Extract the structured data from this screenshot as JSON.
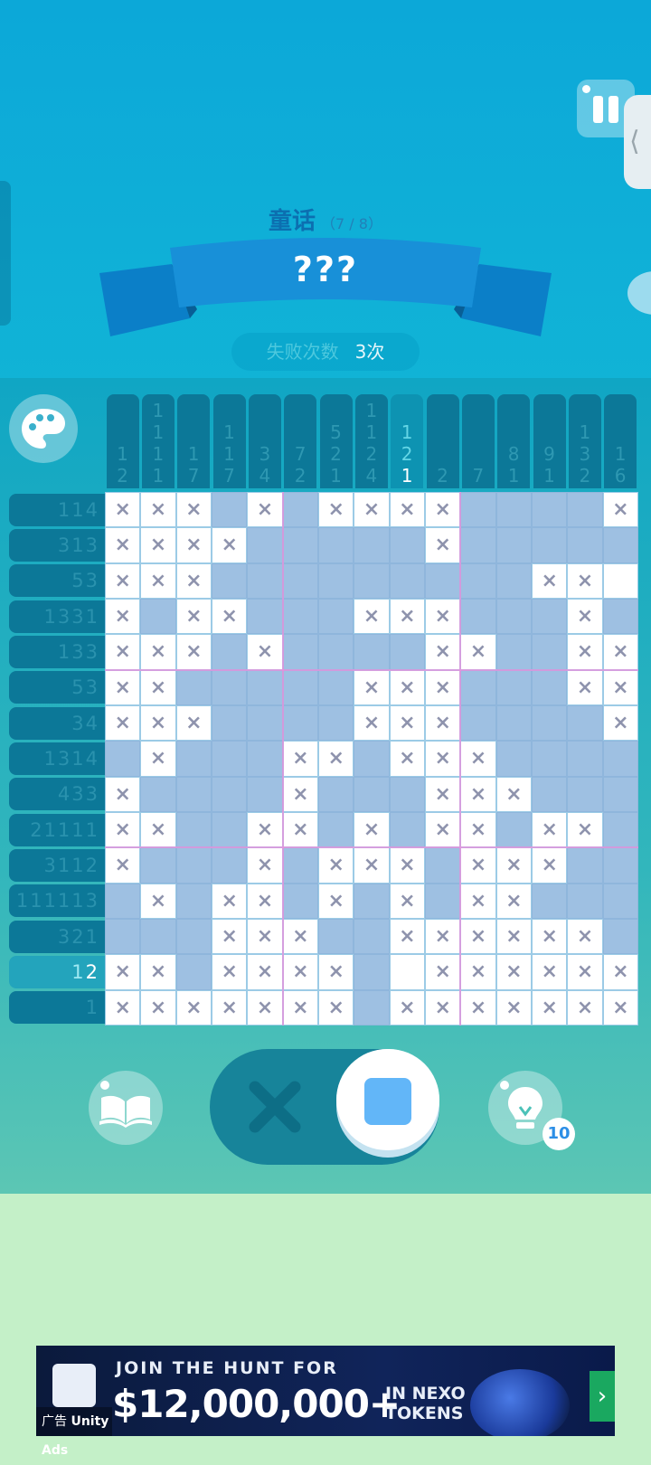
{
  "header": {
    "chapter_name": "童话",
    "chapter_progress": "（7 / 8）",
    "puzzle_title": "???",
    "fail_label": "失败次数",
    "fail_value": "3次",
    "side_tab_glyph": "⟨"
  },
  "board": {
    "size": 15,
    "highlight_col": 8,
    "highlight_row": 13,
    "column_clues": [
      [
        "1",
        "2"
      ],
      [
        "1",
        "1",
        "1",
        "1"
      ],
      [
        "1",
        "7"
      ],
      [
        "1",
        "1",
        "7"
      ],
      [
        "3",
        "4"
      ],
      [
        "7",
        "2"
      ],
      [
        "5",
        "2",
        "1"
      ],
      [
        "1",
        "1",
        "2",
        "4"
      ],
      [
        "1",
        "2",
        "1"
      ],
      [
        "2"
      ],
      [
        "7"
      ],
      [
        "8",
        "1"
      ],
      [
        "9",
        "1"
      ],
      [
        "1",
        "3",
        "2"
      ],
      [
        "1",
        "6"
      ]
    ],
    "row_clues": [
      "114",
      "313",
      "53",
      "1331",
      "133",
      "53",
      "34",
      "1314",
      "433",
      "21111",
      "3112",
      "111113",
      "321",
      "12",
      "1"
    ],
    "cells": [
      "xxxFxFxxxx....x",
      "xxxx.....x.....",
      "xxxFF.......xx",
      "x.xx.F.xxx...x.",
      "xxx.x..F.xx..xx",
      "xx.....xxx...xx",
      "xxx....xxx....x",
      ".x...xx.xxx....",
      "x....x...xxx...",
      "xx..xx.x.xx.xx.",
      "x...x.xxx.xxx..",
      ".x.xx.x.x.xx...",
      "...xxx..xxxxxx.",
      "xx.xxxx. xxxxxx",
      "xxxxxxx.xxxxxxx"
    ],
    "cells_legend": "x = crossed, . or F = filled, space = empty"
  },
  "controls": {
    "mode": "fill",
    "hint_count": "10"
  },
  "ad": {
    "line1": "JOIN THE HUNT FOR",
    "line2": "$12,000,000+",
    "line3": "IN NEXO TOKENS",
    "arrow": "›",
    "tag": "广告",
    "provider": "Unity Ads"
  },
  "colors": {
    "filled": "#9ec0e2",
    "cross": "#8e93ad",
    "clue_bg": "#0c7898",
    "accent": "#62b6f8"
  }
}
